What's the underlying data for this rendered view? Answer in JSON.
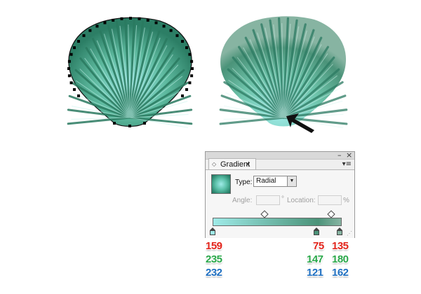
{
  "panel": {
    "tab_title": "Gradient",
    "tab_close": "×",
    "tab_arrows": "◇",
    "menu_icon": "▾≡",
    "minimize": "–",
    "close": "×",
    "type_label": "Type:",
    "type_value": "Radial",
    "angle_label": "Angle:",
    "angle_unit": "°",
    "location_label": "Location:",
    "location_unit": "%"
  },
  "gradient_stops": [
    {
      "name": "left-stop",
      "color": "#9febe8",
      "rgb": {
        "r": "159",
        "g": "235",
        "b": "232"
      }
    },
    {
      "name": "middle-stop",
      "color": "#4b9379",
      "rgb": {
        "r": "75",
        "g": "147",
        "b": "121"
      }
    },
    {
      "name": "right-stop",
      "color": "#87b4a2",
      "rgb": {
        "r": "135",
        "g": "180",
        "b": "162"
      }
    }
  ],
  "colors": {
    "red_value": "#e2231a",
    "green_value": "#2aa84a",
    "blue_value": "#1f6fc0"
  }
}
